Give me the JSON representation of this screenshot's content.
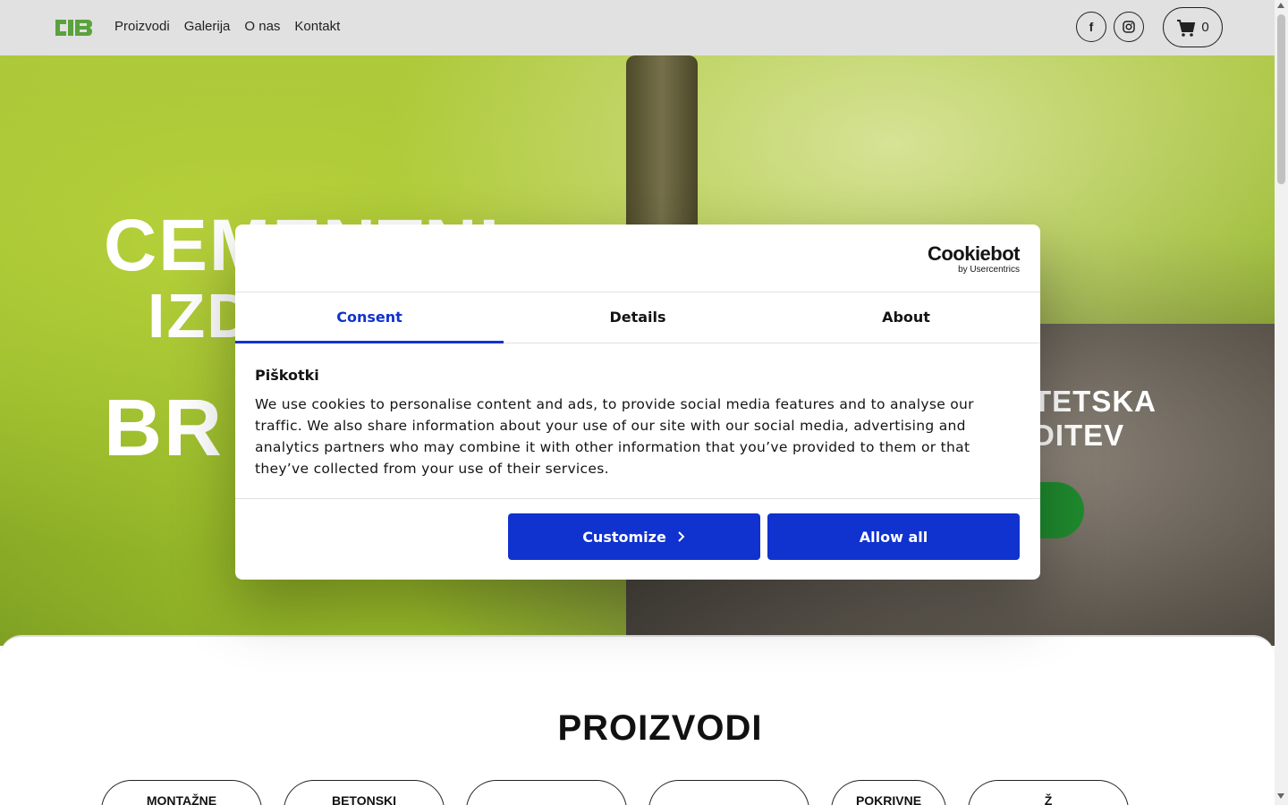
{
  "header": {
    "logo_alt": "CIB",
    "nav": [
      "Proizvodi",
      "Galerija",
      "O nas",
      "Kontakt"
    ],
    "facebook_label": "f",
    "cart_count": "0"
  },
  "hero": {
    "title_line1": "CEMENTNI",
    "title_line2": "IZDELKI",
    "title_line3": "BR",
    "subtitle_line1": "TETSKA",
    "subtitle_line2": "DITEV"
  },
  "products": {
    "title": "PROIZVODI",
    "pills": [
      "MONTAŽNE",
      "BETONSKI",
      "",
      "",
      "POKRIVNE",
      "Ž"
    ]
  },
  "cookie_dialog": {
    "brand": "Cookiebot",
    "brand_sub": "by Usercentrics",
    "tabs": [
      "Consent",
      "Details",
      "About"
    ],
    "heading": "Piškotki",
    "text": "We use cookies to personalise content and ads, to provide social media features and to analyse our traffic. We also share information about your use of our site with our social media, advertising and analytics partners who may combine it with other information that you’ve provided to them or that they’ve collected from your use of their services.",
    "customize_label": "Customize",
    "allow_all_label": "Allow all"
  },
  "colors": {
    "accent": "#1032cf",
    "header_bg": "#e1e1e1",
    "cta_green": "#1f8a2e"
  }
}
